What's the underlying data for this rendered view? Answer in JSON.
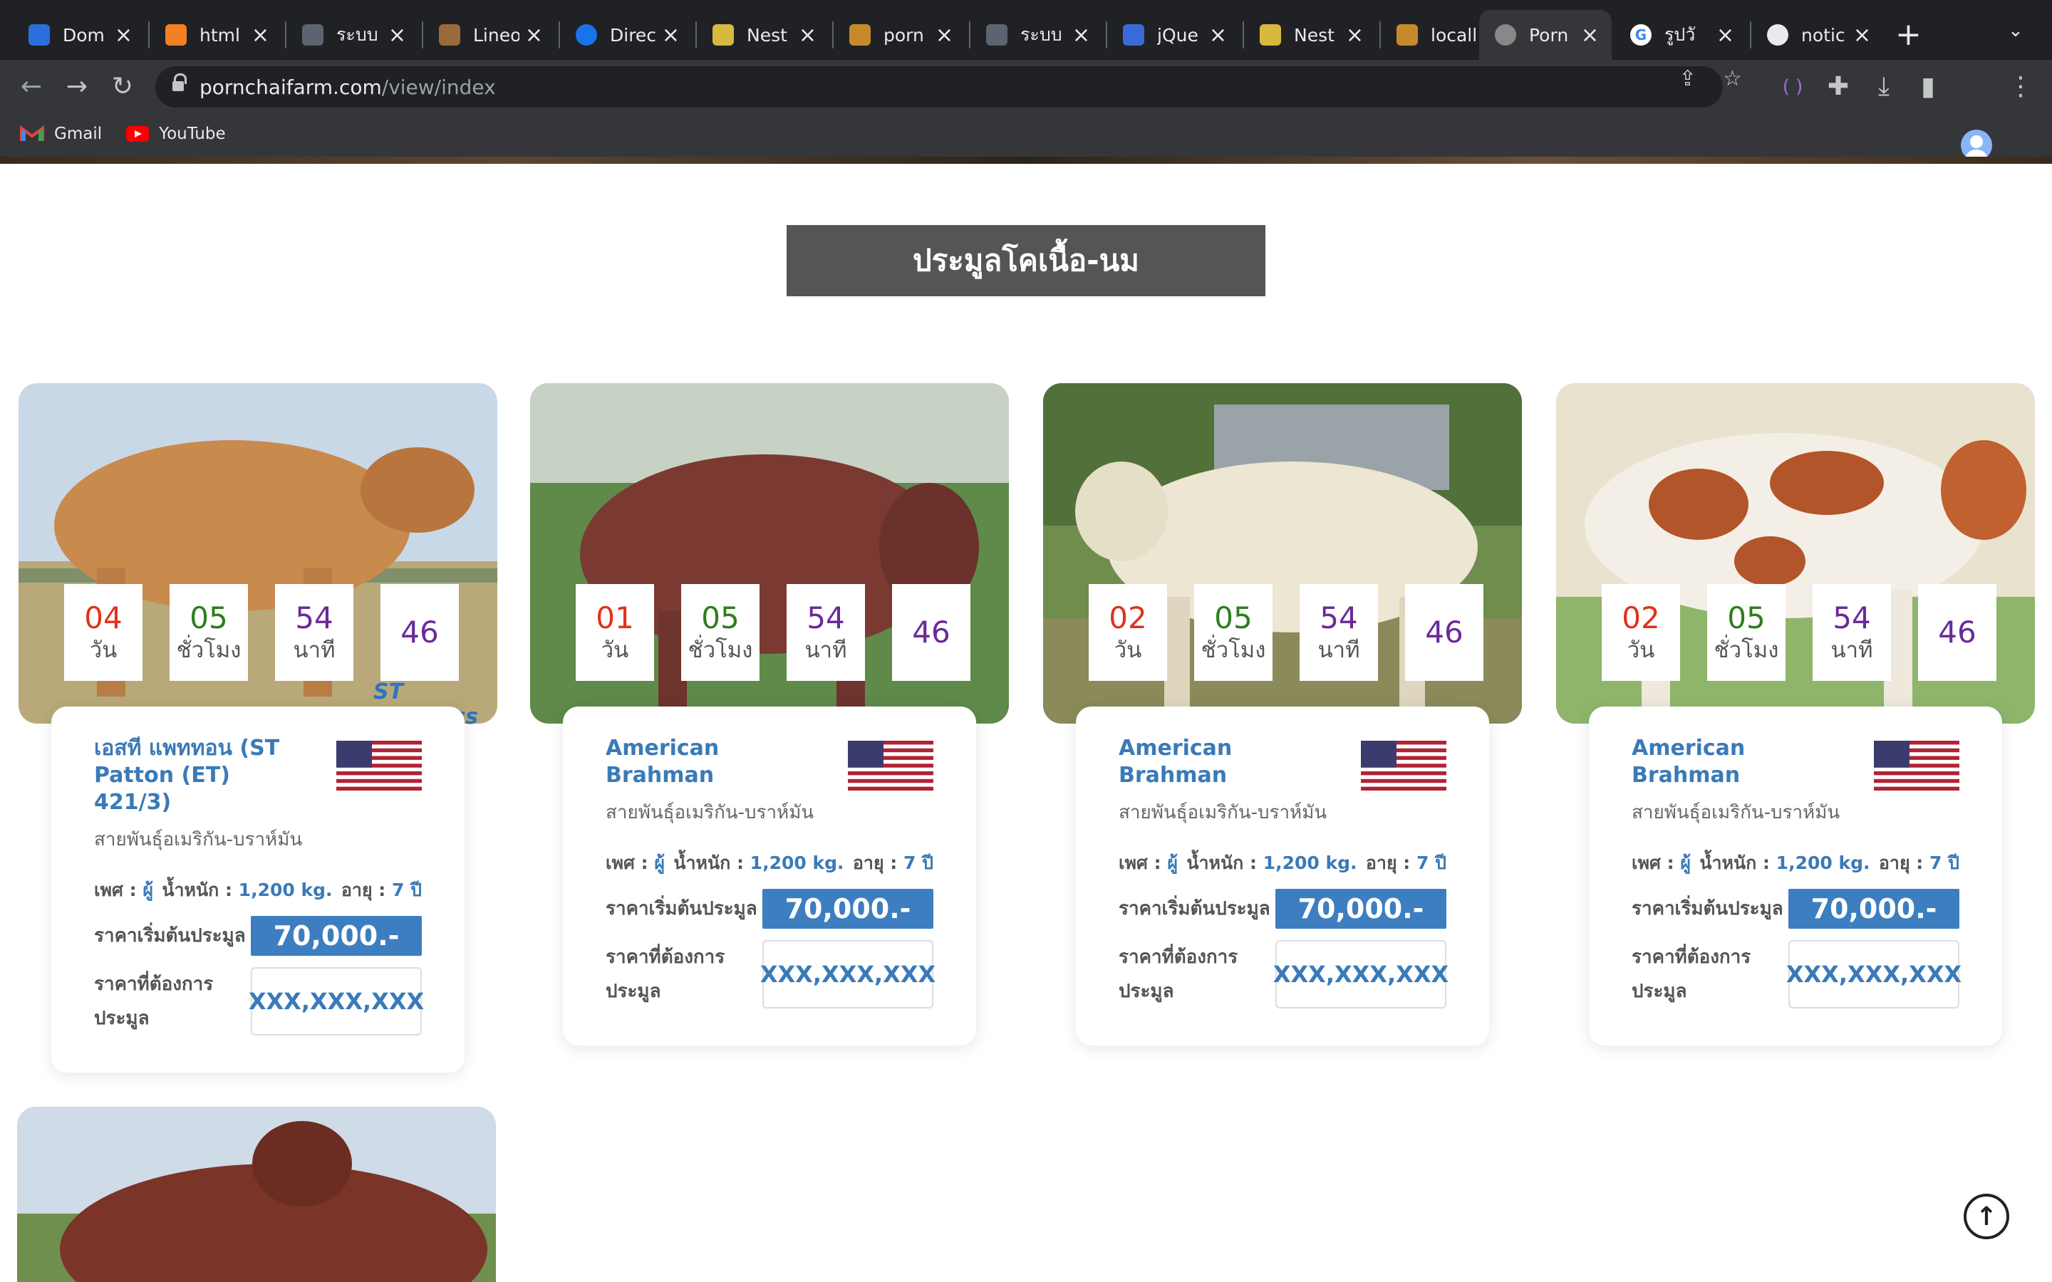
{
  "browser": {
    "tabs": [
      {
        "title": "Dom",
        "icon": "wallet-icon",
        "color": "#2a6fdb"
      },
      {
        "title": "html",
        "icon": "stackoverflow-icon",
        "color": "#f48024"
      },
      {
        "title": "ระบบ",
        "icon": "code-window-icon",
        "color": "#5b6470"
      },
      {
        "title": "Lineo",
        "icon": "lineo-icon",
        "color": "#9b6a3a"
      },
      {
        "title": "Direc",
        "icon": "circle-app-icon",
        "color": "#1a73e8"
      },
      {
        "title": "Nest",
        "icon": "nest-icon",
        "color": "#d7b940"
      },
      {
        "title": "porn",
        "icon": "farm-logo-icon",
        "color": "#c68a2a"
      },
      {
        "title": "ระบบ",
        "icon": "code-window-icon",
        "color": "#5b6470"
      },
      {
        "title": "jQue",
        "icon": "jquery-icon",
        "color": "#3a6ad8"
      },
      {
        "title": "Nest",
        "icon": "nest-icon",
        "color": "#d7b940"
      },
      {
        "title": "locall",
        "icon": "farm-logo-icon",
        "color": "#c68a2a"
      },
      {
        "title": "Porn",
        "icon": "farm-logo-icon",
        "color": "#888888"
      },
      {
        "title": "รูปวั",
        "icon": "google-icon",
        "color": "#4285f4"
      },
      {
        "title": "notic",
        "icon": "globe-icon",
        "color": "#e8eaed"
      }
    ],
    "url_host": "pornchaifarm.com",
    "url_path": "/view/index",
    "bookmarks": [
      {
        "label": "Gmail",
        "icon": "gmail-icon"
      },
      {
        "label": "YouTube",
        "icon": "youtube-icon"
      }
    ]
  },
  "page": {
    "heading": "ประมูลโคเนื้อ-นม",
    "timer_labels": {
      "days": "วัน",
      "hours": "ชั่วโมง",
      "minutes": "นาที"
    },
    "accent_color": "#3d7ec0",
    "cards": [
      {
        "name": "เอสที แพททอน (ST Patton (ET) 421/3)",
        "breed": "สายพันธุ์อเมริกัน-บราห์มัน",
        "countdown": {
          "days": "04",
          "hours": "05",
          "minutes": "54",
          "seconds": "46"
        },
        "sex_label": "เพศ :",
        "sex": "ผู้",
        "weight_label": "น้ำหนัก :",
        "weight": "1,200 kg.",
        "age_label": "อายุ :",
        "age": "7 ปี",
        "start_price_label": "ราคาเริ่มต้นประมูล",
        "start_price": "70,000.-",
        "want_price_label": "ราคาที่ต้องการประมูล",
        "want_price": "XXX,XXX,XXX",
        "flag": "usa-flag-icon",
        "photo_watermark": "ST Genetics"
      },
      {
        "name": "American Brahman",
        "breed": "สายพันธุ์อเมริกัน-บราห์มัน",
        "countdown": {
          "days": "01",
          "hours": "05",
          "minutes": "54",
          "seconds": "46"
        },
        "sex_label": "เพศ :",
        "sex": "ผู้",
        "weight_label": "น้ำหนัก :",
        "weight": "1,200 kg.",
        "age_label": "อายุ :",
        "age": "7 ปี",
        "start_price_label": "ราคาเริ่มต้นประมูล",
        "start_price": "70,000.-",
        "want_price_label": "ราคาที่ต้องการประมูล",
        "want_price": "XXX,XXX,XXX",
        "flag": "usa-flag-icon"
      },
      {
        "name": "American Brahman",
        "breed": "สายพันธุ์อเมริกัน-บราห์มัน",
        "countdown": {
          "days": "02",
          "hours": "05",
          "minutes": "54",
          "seconds": "46"
        },
        "sex_label": "เพศ :",
        "sex": "ผู้",
        "weight_label": "น้ำหนัก :",
        "weight": "1,200 kg.",
        "age_label": "อายุ :",
        "age": "7 ปี",
        "start_price_label": "ราคาเริ่มต้นประมูล",
        "start_price": "70,000.-",
        "want_price_label": "ราคาที่ต้องการประมูล",
        "want_price": "XXX,XXX,XXX",
        "flag": "usa-flag-icon"
      },
      {
        "name": "American Brahman",
        "breed": "สายพันธุ์อเมริกัน-บราห์มัน",
        "countdown": {
          "days": "02",
          "hours": "05",
          "minutes": "54",
          "seconds": "46"
        },
        "sex_label": "เพศ :",
        "sex": "ผู้",
        "weight_label": "น้ำหนัก :",
        "weight": "1,200 kg.",
        "age_label": "อายุ :",
        "age": "7 ปี",
        "start_price_label": "ราคาเริ่มต้นประมูล",
        "start_price": "70,000.-",
        "want_price_label": "ราคาที่ต้องการประมูล",
        "want_price": "XXX,XXX,XXX",
        "flag": "usa-flag-icon"
      }
    ],
    "countdown_colors": {
      "days": "#e0321c",
      "hours": "#2e7d1e",
      "minutes": "#6a2a9a",
      "seconds": "#6a2a9a"
    }
  }
}
